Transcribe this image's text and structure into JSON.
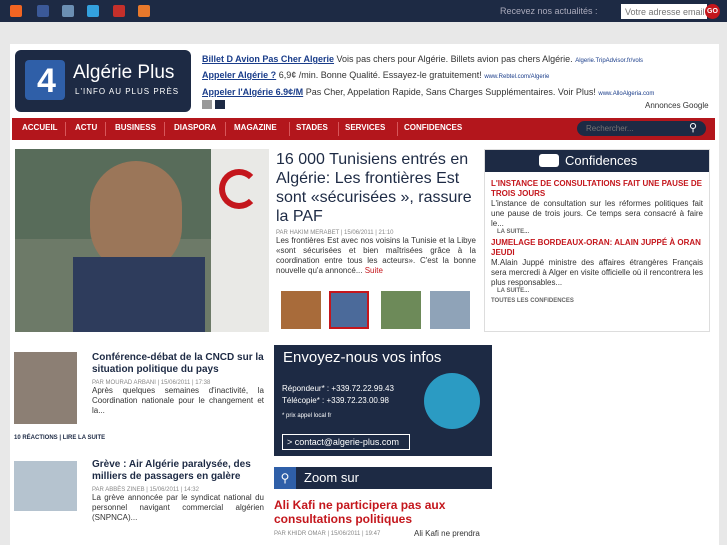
{
  "top_bar": {
    "newsletter_label": "Recevez nos actualités :",
    "email_placeholder": "Votre adresse email",
    "go_label": "GO"
  },
  "brand": {
    "name": "Algérie Plus",
    "tagline": "L'INFO AU PLUS PRÈS",
    "logo_glyph": "4"
  },
  "ads": [
    {
      "title": "Billet D Avion Pas Cher Algerie",
      "text": " Vois pas chers pour Algérie. Billets avion pas chers Algérie.",
      "url": "Algerie.TripAdvisor.fr/vols"
    },
    {
      "title": "Appeler Algérie ?",
      "text": " 6,9¢ /min. Bonne Qualité. Essayez-le gratuitement!",
      "url": "www.Rebtel.com/Algerie"
    },
    {
      "title": "Appeler l'Algérie 6.9¢/M",
      "text": " Pas Cher, Appelation Rapide, Sans Charges Supplémentaires. Voir Plus!",
      "url": "www.AlloAlgeria.com"
    }
  ],
  "ads_label": "Annonces Google",
  "nav": [
    "ACCUEIL",
    "ACTU",
    "BUSINESS",
    "DIASPORA",
    "MAGAZINE",
    "STADES",
    "SERVICES",
    "CONFIDENCES"
  ],
  "search_placeholder": "Rechercher...",
  "featured": {
    "title": "16 000 Tunisiens entrés en Algérie: Les frontières Est sont «sécurisées », rassure la PAF",
    "meta": "PAR HAKIM MERABET | 15/06/2011 | 21:10",
    "body": "Les frontières Est avec nos voisins la Tunisie et la Libye «sont sécurisées et bien maîtrisées grâce à la coordination entre tous les acteurs». C'est la bonne nouvelle qu'a annoncé...",
    "more": "Suite"
  },
  "confidences": {
    "heading": "Confidences",
    "items": [
      {
        "title": "L'INSTANCE DE CONSULTATIONS FAIT UNE PAUSE DE TROIS JOURS",
        "body": "L'instance de consultation sur les réformes politiques fait une pause de trois jours. Ce temps sera consacré à faire le...",
        "more": "LA SUITE..."
      },
      {
        "title": "JUMELAGE BORDEAUX-ORAN: ALAIN JUPPÉ À ORAN JEUDI",
        "body": "M.Alain Juppé ministre des affaires étrangères Français sera mercredi à Alger en visite officielle où il rencontrera les plus responsables...",
        "more": "LA SUITE..."
      }
    ],
    "all": "TOUTES LES CONFIDENCES"
  },
  "news": [
    {
      "title": "Conférence-débat de la CNCD sur la situation politique du pays",
      "meta": "PAR MOURAD ARBANI | 15/06/2011 | 17:38",
      "body": "Après quelques semaines d'inactivité, la Coordination nationale pour le changement et la...",
      "footer": "10 RÉACTIONS | LIRE LA SUITE"
    },
    {
      "title": "Grève : Air Algérie paralysée, des milliers de passagers en galère",
      "meta": "PAR ABBÈS ZINEB | 15/06/2011 | 14:32",
      "body": "La grève annoncée par le syndicat national du personnel navigant commercial algérien (SNPNCA)..."
    }
  ],
  "contact": {
    "heading": "Envoyez-nous vos infos",
    "phone_label": "Répondeur* :",
    "phone": "+339.72.22.99.43",
    "fax_label": "Télécopie* :",
    "fax": "+339.72.23.00.98",
    "note": "* prix appel local fr",
    "email": "> contact@algerie-plus.com"
  },
  "zoom": {
    "heading": "Zoom sur",
    "title": "Ali Kafi ne participera pas aux consultations politiques",
    "meta": "PAR KHIDR OMAR | 15/06/2011 | 19:47",
    "body": "Ali Kafi ne prendra"
  },
  "colors": {
    "navy": "#1d2a44",
    "red": "#b3161c",
    "accent": "#c4161c"
  }
}
